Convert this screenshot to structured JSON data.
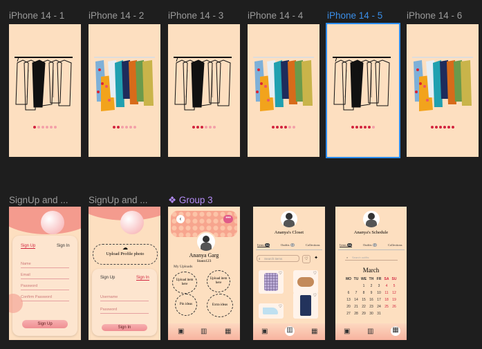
{
  "canvas": {
    "background": "#1e1e1e",
    "selection_color": "#2a8cf0"
  },
  "frames_row1": [
    {
      "label": "iPhone 14 - 1",
      "rack": "sketch",
      "active_dot": 0
    },
    {
      "label": "iPhone 14 - 2",
      "rack": "color",
      "active_dot": 1
    },
    {
      "label": "iPhone 14 - 3",
      "rack": "sketch",
      "active_dot": 2
    },
    {
      "label": "iPhone 14 - 4",
      "rack": "color",
      "active_dot": 3
    },
    {
      "label": "iPhone 14 - 5",
      "rack": "sketch",
      "active_dot": 4,
      "selected": true
    },
    {
      "label": "iPhone 14 - 6",
      "rack": "color",
      "active_dot": 5
    }
  ],
  "frames_row2": [
    {
      "label": "SignUp and ..."
    },
    {
      "label": "SignUp and ..."
    },
    {
      "label": "Group 3",
      "group": true
    }
  ],
  "signup1": {
    "tab_signup": "Sign Up",
    "tab_signin": "Sign In",
    "fields": [
      "Name",
      "Email",
      "Password",
      "Confirm Password"
    ],
    "button": "Sign Up"
  },
  "signup2": {
    "upload": "Upload Profile photo",
    "tab_signup": "Sign Up",
    "tab_signin": "Sign In",
    "fields": [
      "Username",
      "Password"
    ],
    "button": "Sign In"
  },
  "profile": {
    "name": "Ananya Garg",
    "handle": "Stann123",
    "section": "My Uploads",
    "bubbles": [
      "Upload item here",
      "Upload item here",
      "Pin ideas",
      "Extra ideas"
    ]
  },
  "closet": {
    "title": "Ananya's Closet",
    "tabs": [
      "Items",
      "Outfits",
      "Collections"
    ],
    "badges": [
      "34",
      "12"
    ],
    "search_placeholder": "Search items"
  },
  "schedule": {
    "title": "Ananya's Schedule",
    "tabs": [
      "Items",
      "Outfits",
      "Collections"
    ],
    "badges": [
      "34",
      "12"
    ],
    "search_placeholder": "Search outfits",
    "month": "March",
    "weekdays": [
      "MO",
      "TU",
      "WE",
      "TH",
      "FR",
      "SA",
      "SU"
    ],
    "weeks": [
      [
        "",
        "",
        "1",
        "2",
        "3",
        "4",
        "5"
      ],
      [
        "6",
        "7",
        "8",
        "9",
        "10",
        "11",
        "12"
      ],
      [
        "13",
        "14",
        "15",
        "16",
        "17",
        "18",
        "19"
      ],
      [
        "20",
        "21",
        "22",
        "23",
        "24",
        "25",
        "26"
      ],
      [
        "27",
        "28",
        "29",
        "30",
        "31",
        "",
        ""
      ]
    ]
  }
}
